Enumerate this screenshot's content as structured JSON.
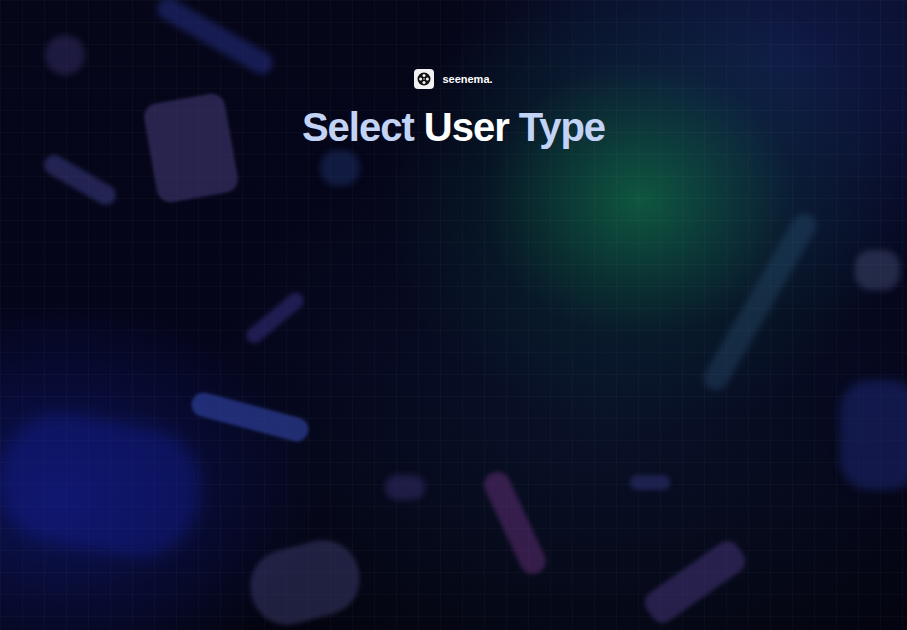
{
  "brand": {
    "name": "seenema."
  },
  "title": {
    "words": [
      {
        "text": "Select",
        "color": "#c3d3f5"
      },
      {
        "text": "User",
        "color": "#ffffff"
      },
      {
        "text": "Type",
        "color": "#c3d3f5"
      }
    ]
  }
}
